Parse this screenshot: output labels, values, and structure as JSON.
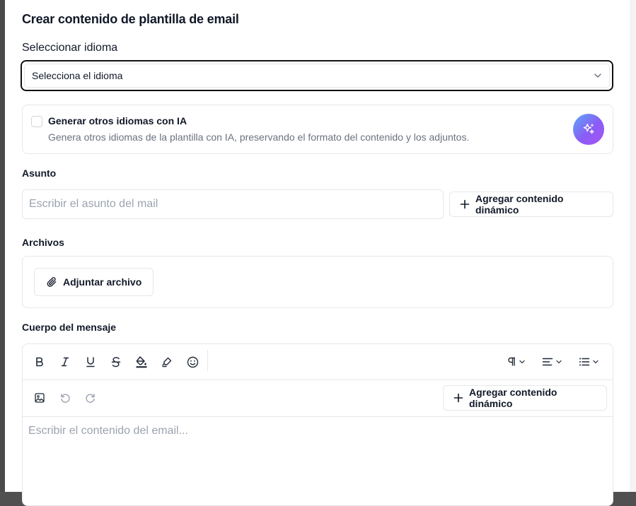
{
  "modal": {
    "title": "Crear contenido de plantilla de email"
  },
  "language": {
    "label": "Seleccionar idioma",
    "selected": "Selecciona el idioma"
  },
  "ai": {
    "title": "Generar otros idiomas con IA",
    "description": "Genera otros idiomas de la plantilla con IA, preservando el formato del contenido y los adjuntos.",
    "checked": false
  },
  "subject": {
    "label": "Asunto",
    "placeholder": "Escribir el asunto del mail",
    "value": "",
    "dynamic_button": "Agregar contenido dinámico"
  },
  "files": {
    "label": "Archivos",
    "attach_button": "Adjuntar archivo"
  },
  "body": {
    "label": "Cuerpo del mensaje",
    "placeholder": "Escribir el contenido del email...",
    "dynamic_button": "Agregar contenido dinámico"
  },
  "toolbar": {
    "icons": [
      "bold-icon",
      "italic-icon",
      "underline-icon",
      "strikethrough-icon",
      "fill-color-icon",
      "highlighter-icon",
      "emoji-icon",
      "paragraph-icon",
      "align-icon",
      "list-icon",
      "image-icon",
      "undo-icon",
      "redo-icon"
    ]
  },
  "colors": {
    "accent_gradient_start": "#5aa9f5",
    "accent_gradient_end": "#a855f7",
    "border": "#e5e7eb",
    "muted_text": "#6b7280",
    "placeholder": "#9ca3af"
  }
}
